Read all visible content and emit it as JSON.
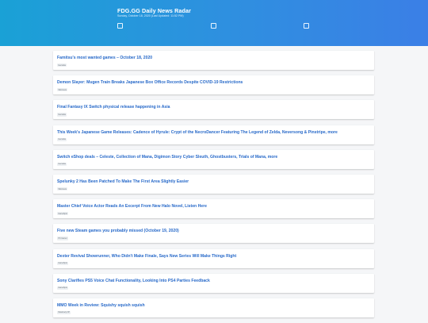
{
  "header": {
    "title": "FDG.GG Daily News Radar",
    "subtitle": "Sunday, October 18, 2020 (Last Updated: 11:52 PM)",
    "icons": [
      "checkbox-icon-1",
      "checkbox-icon-2",
      "checkbox-icon-3"
    ]
  },
  "articles": [
    {
      "title": "Famitsu's most wanted games – October 18, 2020",
      "source": "Gematsu"
    },
    {
      "title": "Demon Slayer: Mugen Train Breaks Japanese Box Office Records Despite COVID-19 Restrictions",
      "source": "Siliconera"
    },
    {
      "title": "Final Fantasy IX Switch physical release happening in Asia",
      "source": "Gematsu"
    },
    {
      "title": "This Week's Japanese Game Releases: Cadence of Hyrule: Crypt of the NecroDancer Featuring The Legend of Zelda, Neversong & Pinstripe, more",
      "source": "Gematsu"
    },
    {
      "title": "Switch eShop deals – Celeste, Collection of Mana, Digimon Story Cyber Sleuth, Ghostbusters, Trials of Mana, more",
      "source": "Gematsu"
    },
    {
      "title": "Spelunky 2 Has Been Patched To Make The First Area Slightly Easier",
      "source": "Siliconera"
    },
    {
      "title": "Master Chief Voice Actor Reads An Excerpt From New Halo Novel, Listen Here",
      "source": "GameSpot"
    },
    {
      "title": "Five new Steam games you probably missed (October 19, 2020)",
      "source": "PC Gamer"
    },
    {
      "title": "Dexter Revival Showrunner, Who Didn't Make Finale, Says New Series Will Make Things Right",
      "source": "GameSpot"
    },
    {
      "title": "Sony Clarifies PS5 Voice Chat Functionality, Looking Into PS4 Parties Feedback",
      "source": "GameSpot"
    },
    {
      "title": "MMO Week in Review: Squishy squish squish",
      "source": "Massively OP"
    }
  ]
}
